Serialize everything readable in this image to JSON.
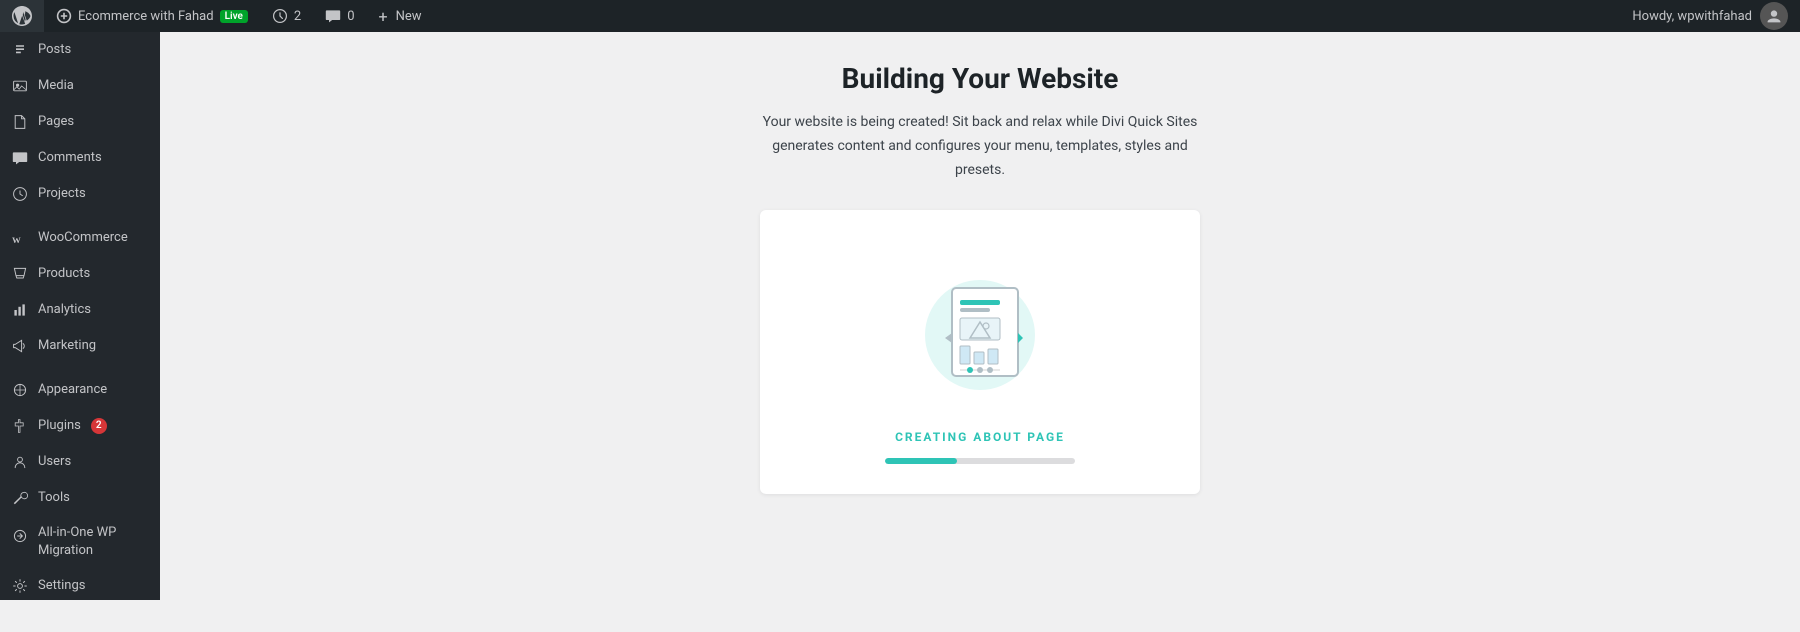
{
  "adminbar": {
    "site_name": "Ecommerce with Fahad",
    "live_label": "Live",
    "updates_count": "2",
    "comments_count": "0",
    "new_label": "New",
    "howdy_label": "Howdy, wpwithfahad"
  },
  "sidebar": {
    "items": [
      {
        "id": "posts",
        "label": "Posts",
        "icon": "posts-icon"
      },
      {
        "id": "media",
        "label": "Media",
        "icon": "media-icon"
      },
      {
        "id": "pages",
        "label": "Pages",
        "icon": "pages-icon"
      },
      {
        "id": "comments",
        "label": "Comments",
        "icon": "comments-icon"
      },
      {
        "id": "projects",
        "label": "Projects",
        "icon": "projects-icon"
      },
      {
        "id": "woocommerce",
        "label": "WooCommerce",
        "icon": "woo-icon"
      },
      {
        "id": "products",
        "label": "Products",
        "icon": "products-icon"
      },
      {
        "id": "analytics",
        "label": "Analytics",
        "icon": "analytics-icon"
      },
      {
        "id": "marketing",
        "label": "Marketing",
        "icon": "marketing-icon"
      },
      {
        "id": "appearance",
        "label": "Appearance",
        "icon": "appearance-icon"
      },
      {
        "id": "plugins",
        "label": "Plugins",
        "icon": "plugins-icon",
        "badge": "2"
      },
      {
        "id": "users",
        "label": "Users",
        "icon": "users-icon"
      },
      {
        "id": "tools",
        "label": "Tools",
        "icon": "tools-icon"
      },
      {
        "id": "all-in-one",
        "label": "All-in-One WP Migration",
        "icon": "migration-icon"
      },
      {
        "id": "settings",
        "label": "Settings",
        "icon": "settings-icon"
      }
    ]
  },
  "main": {
    "title": "Building Your Website",
    "subtitle": "Your website is being created! Sit back and relax while Divi Quick Sites generates content and configures your menu, templates, styles and presets.",
    "creating_label": "CREATING ABOUT PAGE",
    "progress_percent": 38
  }
}
